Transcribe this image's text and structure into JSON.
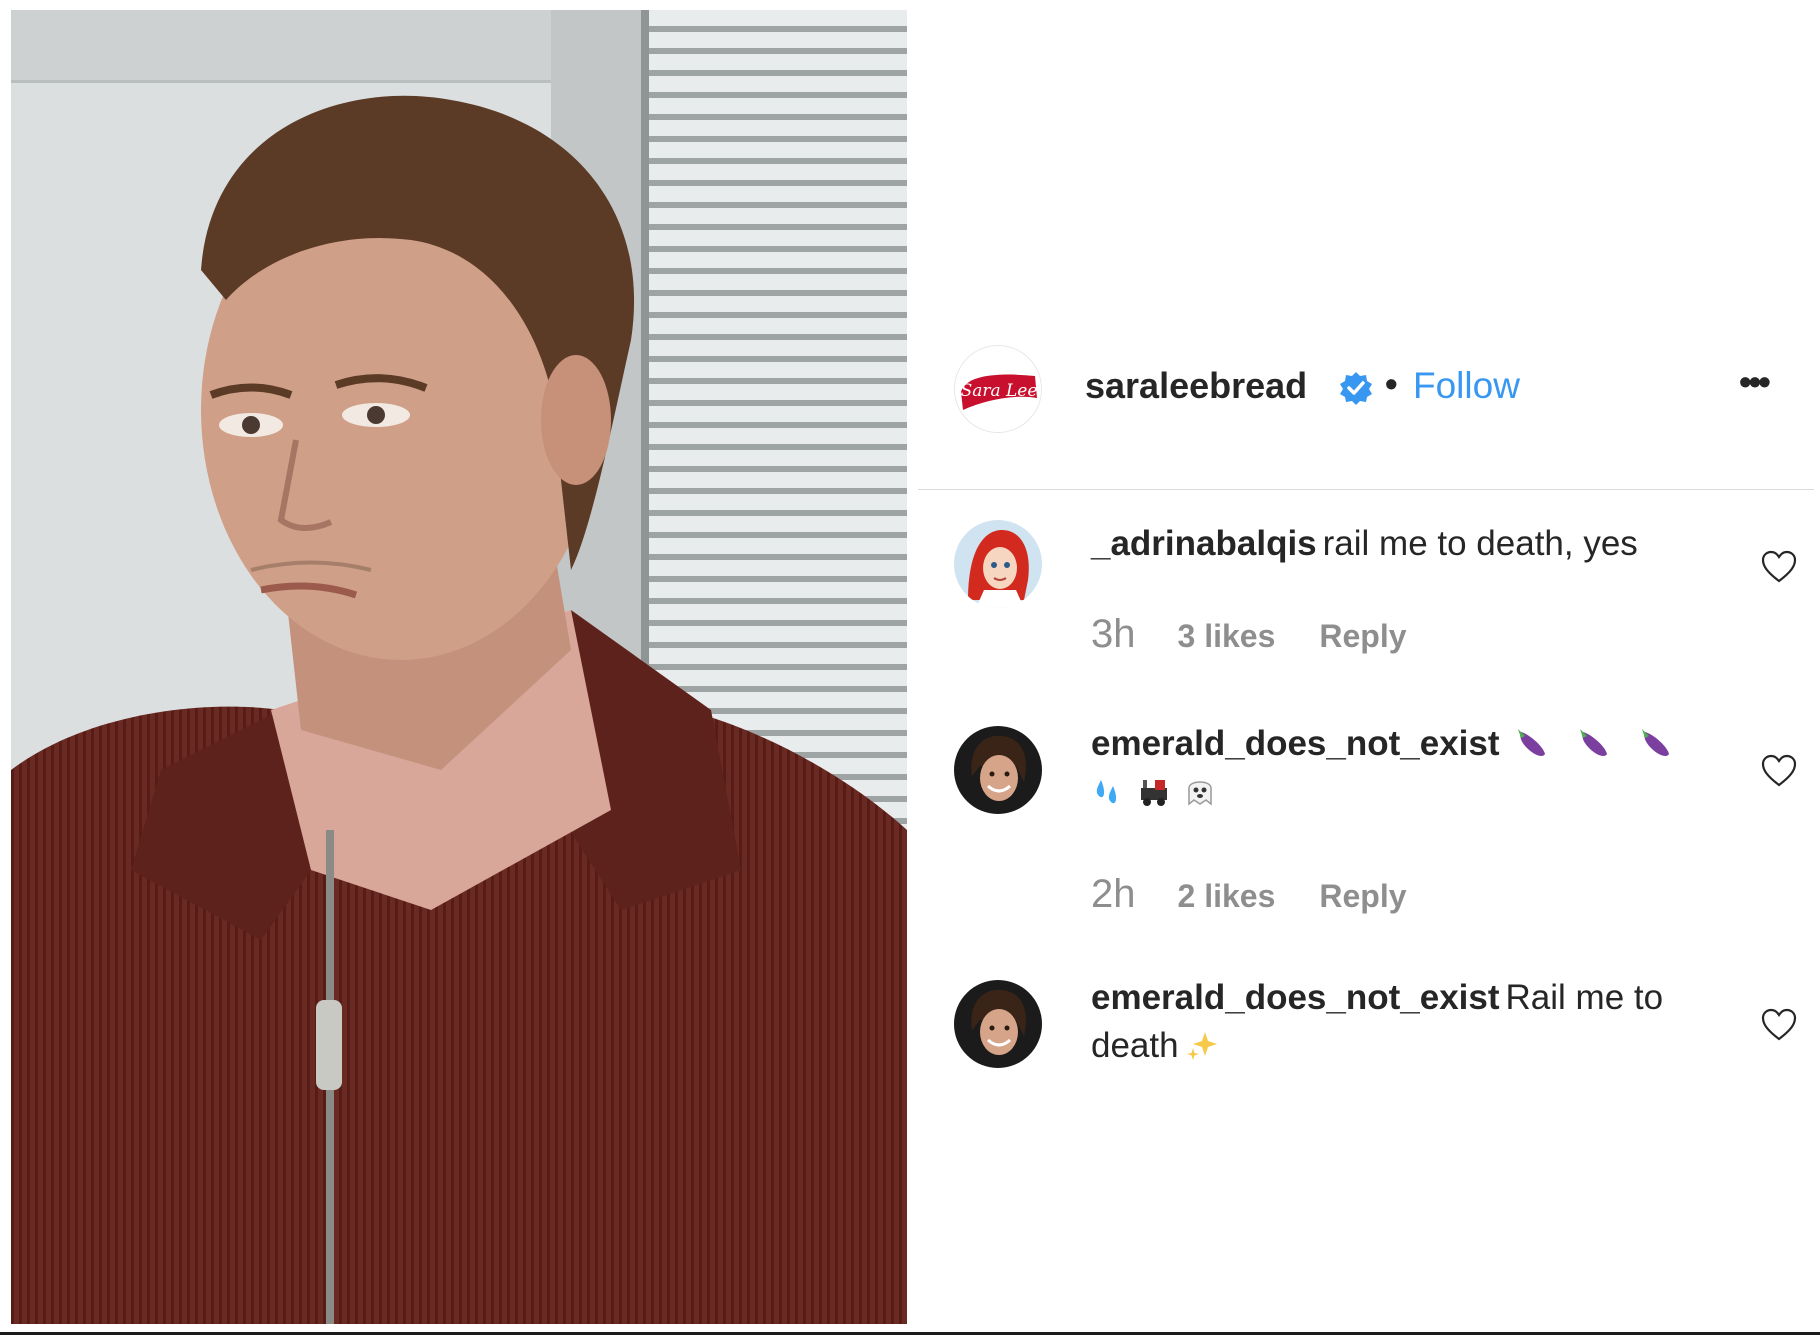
{
  "post": {
    "account": {
      "username": "saraleebread",
      "verified": true,
      "follow_label": "Follow",
      "separator": "•",
      "more_label": "•••",
      "avatar_logo_text": "Sara Lee"
    }
  },
  "comments": [
    {
      "username": "_adrinabalqis",
      "text": "rail me to death, yes",
      "emojis": [],
      "time": "3h",
      "likes": "3 likes",
      "reply": "Reply"
    },
    {
      "username": "emerald_does_not_exist",
      "text": "",
      "emojis": [
        "eggplant",
        "eggplant",
        "eggplant",
        "sweat-droplets",
        "locomotive",
        "ghost"
      ],
      "time": "2h",
      "likes": "2 likes",
      "reply": "Reply"
    },
    {
      "username": "emerald_does_not_exist",
      "text": "Rail me to death",
      "emojis": [
        "sparkles"
      ],
      "time": "",
      "likes": "",
      "reply": ""
    }
  ],
  "colors": {
    "follow": "#3897f0",
    "verified_badge": "#3897f0",
    "meta_text": "#8e8e8e",
    "username": "#262626",
    "divider": "#dbdbdb",
    "brand_red": "#c8102e"
  },
  "icons": {
    "verified": "verified-badge-icon",
    "heart": "heart-outline-icon",
    "more": "more-options-icon"
  }
}
